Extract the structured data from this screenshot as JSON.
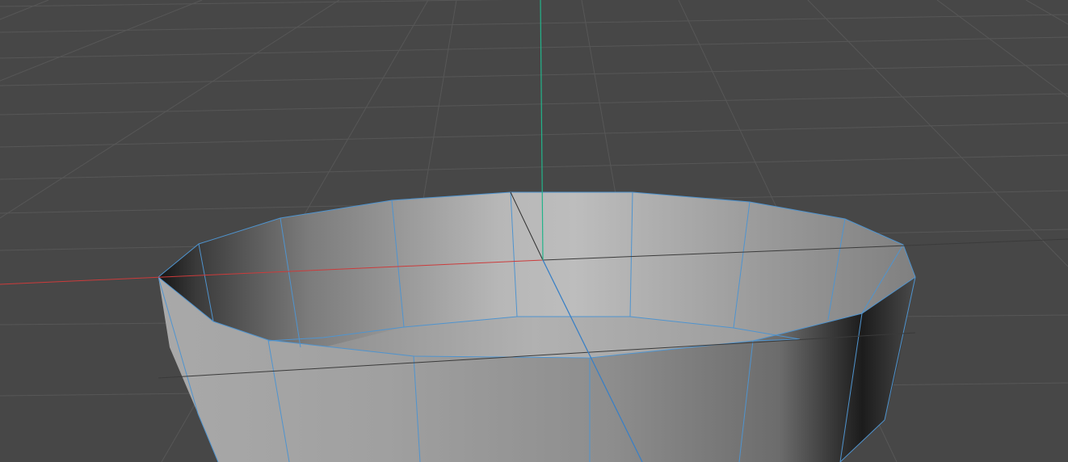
{
  "viewport": {
    "background_color": "#474747",
    "grid_color": "#575757",
    "axis_colors": {
      "x": "#cc3b3b",
      "y": "#22b48a",
      "z": "#3a7fc4"
    },
    "wireframe_color": "#4f94cf",
    "object": "cylinder-bowl-mesh"
  }
}
